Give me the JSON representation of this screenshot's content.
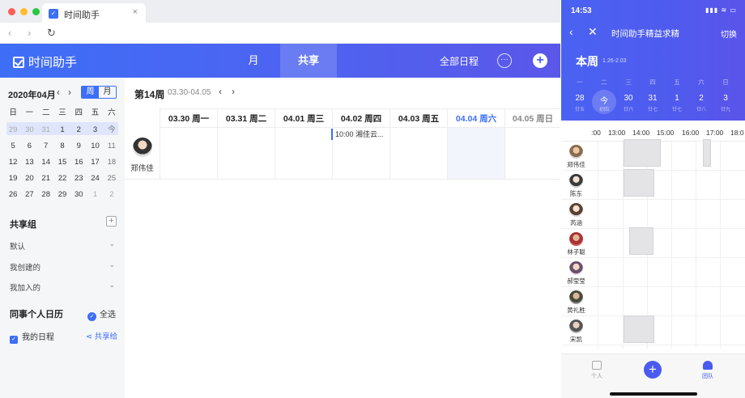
{
  "browser": {
    "tab_title": "时间助手",
    "tab_close": "×",
    "traffic_colors": [
      "#fe5f57",
      "#febc2e",
      "#28c840"
    ]
  },
  "header": {
    "app_name": "时间助手",
    "tabs": [
      "月",
      "共享"
    ],
    "active_tab": "共享",
    "all_schedules": "全部日程",
    "more": "···",
    "add": "+"
  },
  "sidebar": {
    "calendar_title": "2020年04月",
    "toggle": [
      "周",
      "月"
    ],
    "weekday_headers": [
      "日",
      "一",
      "二",
      "三",
      "四",
      "五",
      "六"
    ],
    "days": [
      {
        "t": "29",
        "c": "muted"
      },
      {
        "t": "30",
        "c": "muted"
      },
      {
        "t": "31",
        "c": "muted"
      },
      {
        "t": "1",
        "c": ""
      },
      {
        "t": "2",
        "c": ""
      },
      {
        "t": "3",
        "c": ""
      },
      {
        "t": "今",
        "c": "wkend"
      },
      {
        "t": "5",
        "c": ""
      },
      {
        "t": "6",
        "c": ""
      },
      {
        "t": "7",
        "c": ""
      },
      {
        "t": "8",
        "c": ""
      },
      {
        "t": "9",
        "c": ""
      },
      {
        "t": "10",
        "c": ""
      },
      {
        "t": "11",
        "c": "wkend"
      },
      {
        "t": "12",
        "c": ""
      },
      {
        "t": "13",
        "c": ""
      },
      {
        "t": "14",
        "c": ""
      },
      {
        "t": "15",
        "c": ""
      },
      {
        "t": "16",
        "c": ""
      },
      {
        "t": "17",
        "c": ""
      },
      {
        "t": "18",
        "c": "wkend"
      },
      {
        "t": "19",
        "c": ""
      },
      {
        "t": "20",
        "c": ""
      },
      {
        "t": "21",
        "c": ""
      },
      {
        "t": "22",
        "c": ""
      },
      {
        "t": "23",
        "c": ""
      },
      {
        "t": "24",
        "c": ""
      },
      {
        "t": "25",
        "c": "wkend"
      },
      {
        "t": "26",
        "c": ""
      },
      {
        "t": "27",
        "c": ""
      },
      {
        "t": "28",
        "c": ""
      },
      {
        "t": "29",
        "c": ""
      },
      {
        "t": "30",
        "c": ""
      },
      {
        "t": "1",
        "c": "muted"
      },
      {
        "t": "2",
        "c": "muted"
      }
    ],
    "group_title": "共享组",
    "groups": [
      "默认",
      "我创建的",
      "我加入的"
    ],
    "colleague_title": "同事个人日历",
    "select_all": "全选",
    "my_schedule": "我的日程",
    "share_to": "共享给"
  },
  "main": {
    "week_label": "第14周",
    "week_range": "03.30-04.05",
    "days": [
      "03.30 周一",
      "03.31 周二",
      "04.01 周三",
      "04.02 周四",
      "04.03 周五",
      "04.04 周六",
      "04.05 周日"
    ],
    "today_index": 5,
    "person": "郑伟佳",
    "event_text": "10:00 湘佳云..."
  },
  "phone": {
    "time": "14:53",
    "status": "▮▮▮ ≋ ▭",
    "title": "时间助手精益求精",
    "switch": "切换",
    "week_title": "本周",
    "week_range": "1.26-2.03",
    "weekdays": [
      "一",
      "二",
      "三",
      "四",
      "五",
      "六",
      "日"
    ],
    "dates": [
      "28",
      "今",
      "30",
      "31",
      "1",
      "2",
      "3"
    ],
    "lunar": [
      "廿五",
      "初四",
      "廿六",
      "廿七",
      "廿七",
      "廿八",
      "廿九"
    ],
    "hours": [
      ":00",
      "13:00",
      "14:00",
      "15:00",
      "16:00",
      "17:00",
      "18:0"
    ],
    "people": [
      "郑伟佳",
      "陈东",
      "芮涵",
      "林子聪",
      "郝莹莹",
      "黄礼胜",
      "宋凯"
    ],
    "nav_personal": "个人",
    "nav_team": "团队",
    "fab": "+"
  }
}
